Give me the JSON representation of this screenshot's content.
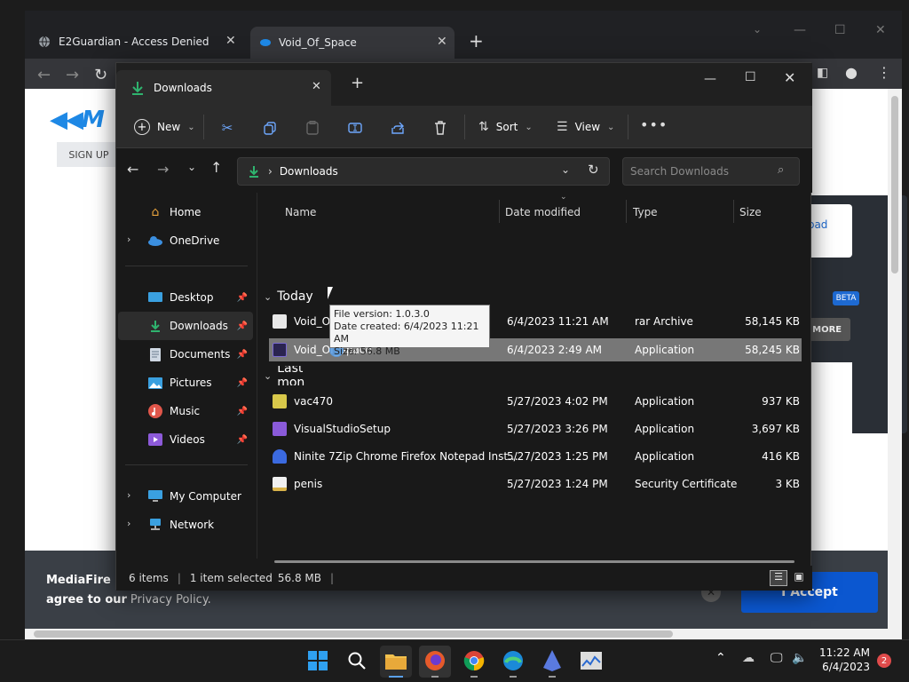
{
  "browser": {
    "tabs": [
      {
        "title": "E2Guardian - Access Denied"
      },
      {
        "title": "Void_Of_Space"
      }
    ],
    "page": {
      "brand": "M",
      "signup": "SIGN UP",
      "download_partial": "ownload",
      "beta": "BETA",
      "learn_more": "ARN MORE",
      "cookie_text_1": "MediaFire us",
      "cookie_text_2": "agree to our",
      "cookie_link": "Privacy Policy.",
      "accept": "I Accept"
    }
  },
  "explorer": {
    "tab_title": "Downloads",
    "toolbar": {
      "new": "New",
      "sort": "Sort",
      "view": "View"
    },
    "address": {
      "path": "Downloads",
      "search_placeholder": "Search Downloads"
    },
    "nav": {
      "home": "Home",
      "onedrive": "OneDrive",
      "desktop": "Desktop",
      "downloads": "Downloads",
      "documents": "Documents",
      "pictures": "Pictures",
      "music": "Music",
      "videos": "Videos",
      "mycomputer": "My Computer",
      "network": "Network"
    },
    "columns": {
      "name": "Name",
      "date": "Date modified",
      "type": "Type",
      "size": "Size"
    },
    "groups": {
      "today": "Today",
      "last": "Last mon"
    },
    "files": [
      {
        "name": "Void_Of_Space",
        "date": "6/4/2023 11:21 AM",
        "type": "rar Archive",
        "size": "58,145 KB"
      },
      {
        "name": "Void_Of_Space",
        "date": "6/4/2023 2:49 AM",
        "type": "Application",
        "size": "58,245 KB"
      },
      {
        "name": "vac470",
        "date": "5/27/2023 4:02 PM",
        "type": "Application",
        "size": "937 KB"
      },
      {
        "name": "VisualStudioSetup",
        "date": "5/27/2023 3:26 PM",
        "type": "Application",
        "size": "3,697 KB"
      },
      {
        "name": "Ninite 7Zip Chrome Firefox Notepad Inst...",
        "date": "5/27/2023 1:25 PM",
        "type": "Application",
        "size": "416 KB"
      },
      {
        "name": "penis",
        "date": "5/27/2023 1:24 PM",
        "type": "Security Certificate",
        "size": "3 KB"
      }
    ],
    "tooltip": {
      "line1": "File version: 1.0.3.0",
      "line2": "Date created: 6/4/2023 11:21 AM",
      "line3": "Size: 56.8 MB"
    },
    "status": {
      "items": "6 items",
      "selected": "1 item selected",
      "size": "56.8 MB"
    }
  },
  "taskbar": {
    "time": "11:22 AM",
    "date": "6/4/2023",
    "badge": "2"
  },
  "colors": {
    "accent": "#0b57d0",
    "explorer_bg": "#191919",
    "selected_row": "#777777"
  }
}
